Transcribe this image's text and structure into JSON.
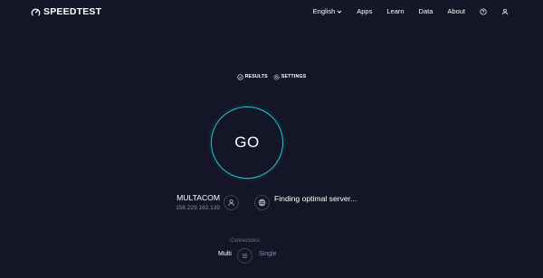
{
  "header": {
    "logo_text": "SPEEDTEST",
    "nav": {
      "language": "English",
      "apps": "Apps",
      "learn": "Learn",
      "data": "Data",
      "about": "About"
    }
  },
  "toolbar": {
    "results_label": "RESULTS",
    "settings_label": "SETTINGS"
  },
  "main": {
    "go_label": "GO",
    "isp_name": "MULTACOM",
    "isp_ip": "156.229.162.139",
    "server_status": "Finding optimal server..."
  },
  "connections": {
    "label": "Connections",
    "multi": "Multi",
    "single": "Single",
    "selected": "Multi"
  },
  "colors": {
    "background": "#141526",
    "accent": "#27c2d3",
    "muted_text": "#8a8ea3"
  },
  "icons": [
    "speedtest-logo-icon",
    "chevron-down-icon",
    "help-icon",
    "user-icon",
    "check-circle-icon",
    "settings-icon",
    "globe-icon",
    "connections-icon"
  ]
}
